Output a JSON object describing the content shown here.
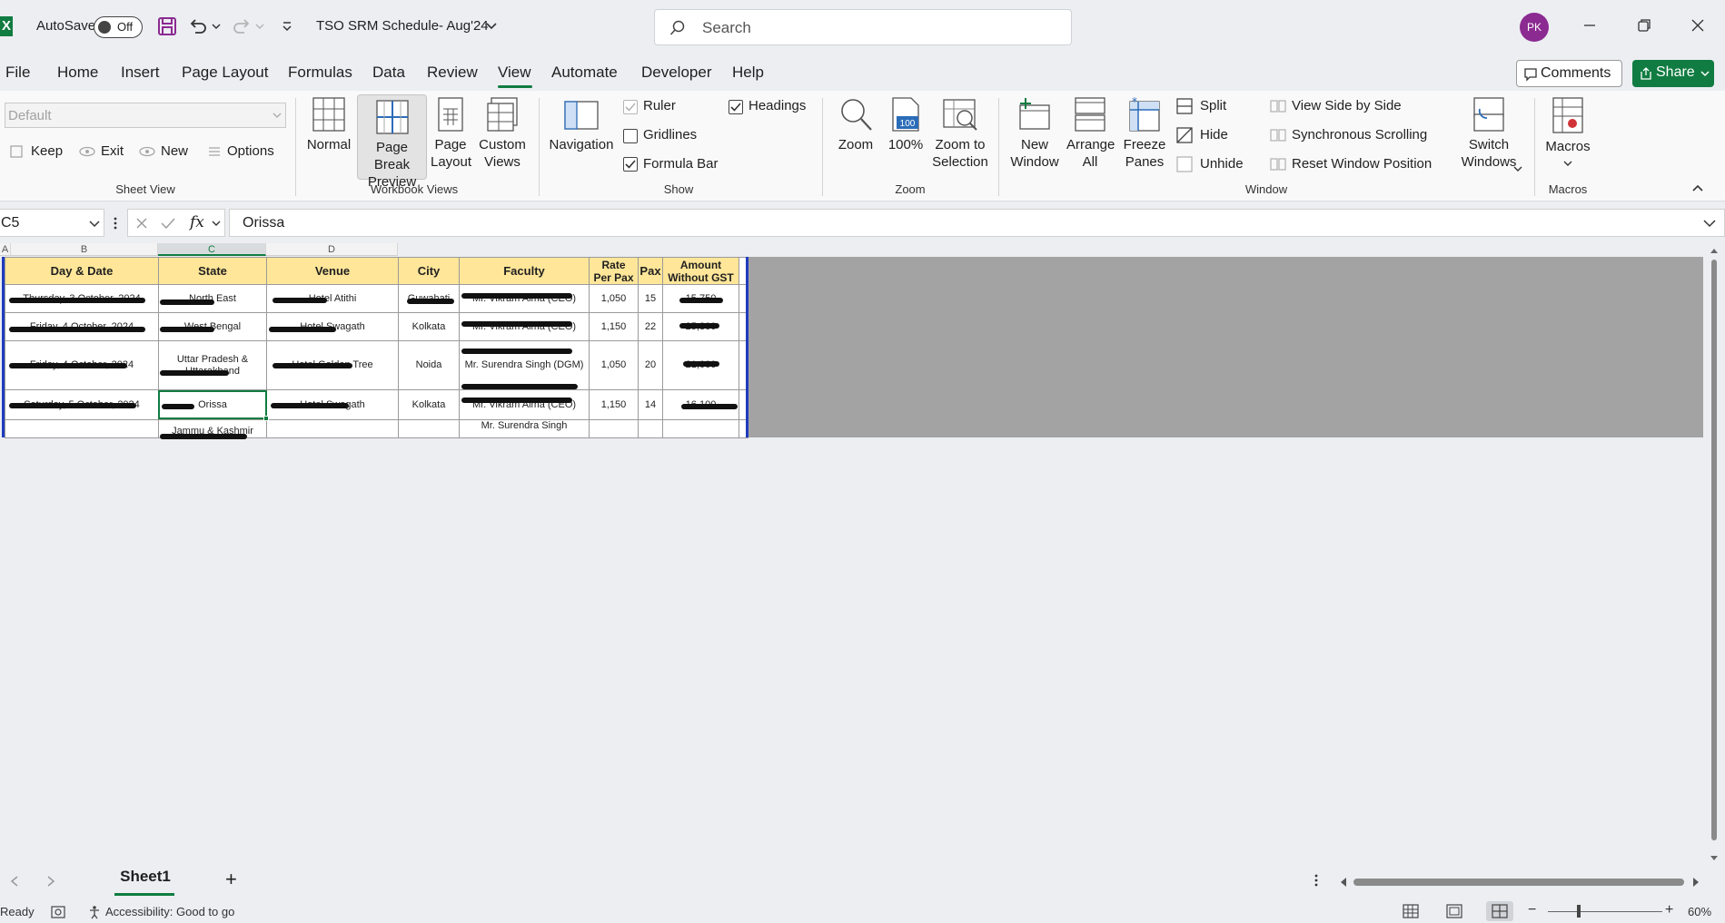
{
  "titlebar": {
    "autosave_label": "AutoSave",
    "autosave_state": "Off",
    "doc_title": "TSO SRM Schedule- Aug'24",
    "search_placeholder": "Search",
    "user_initials": "PK"
  },
  "menu": {
    "tabs": [
      "File",
      "Home",
      "Insert",
      "Page Layout",
      "Formulas",
      "Data",
      "Review",
      "View",
      "Automate",
      "Developer",
      "Help"
    ],
    "active_tab": "View",
    "comments_label": "Comments",
    "share_label": "Share"
  },
  "ribbon": {
    "sheet_view": {
      "select_value": "Default",
      "keep": "Keep",
      "exit": "Exit",
      "new": "New",
      "options": "Options",
      "group_label": "Sheet View"
    },
    "workbook_views": {
      "normal": "Normal",
      "page_break_1": "Page Break",
      "page_break_2": "Preview",
      "page_layout_1": "Page",
      "page_layout_2": "Layout",
      "custom_views_1": "Custom",
      "custom_views_2": "Views",
      "group_label": "Workbook Views"
    },
    "show": {
      "navigation": "Navigation",
      "ruler": "Ruler",
      "gridlines": "Gridlines",
      "formula_bar": "Formula Bar",
      "headings": "Headings",
      "group_label": "Show"
    },
    "zoom": {
      "zoom": "Zoom",
      "hundred": "100%",
      "hundred_icon": "100",
      "zoom_sel_1": "Zoom to",
      "zoom_sel_2": "Selection",
      "group_label": "Zoom"
    },
    "window": {
      "new_window_1": "New",
      "new_window_2": "Window",
      "arrange_1": "Arrange",
      "arrange_2": "All",
      "freeze_1": "Freeze",
      "freeze_2": "Panes",
      "split": "Split",
      "hide": "Hide",
      "unhide": "Unhide",
      "side_by_side": "View Side by Side",
      "sync_scroll": "Synchronous Scrolling",
      "reset_pos": "Reset Window Position",
      "switch_1": "Switch",
      "switch_2": "Windows",
      "group_label": "Window"
    },
    "macros": {
      "macros": "Macros",
      "group_label": "Macros"
    }
  },
  "formula_bar": {
    "name_box": "C5",
    "fx": "fx",
    "content": "Orissa"
  },
  "grid": {
    "col_headers": [
      "A",
      "B",
      "C",
      "D"
    ],
    "headers": [
      "Day & Date",
      "State",
      "Venue",
      "City",
      "Faculty",
      "Rate Per Pax",
      "Pax",
      "Amount Without GST"
    ],
    "header_rate_1": "Rate",
    "header_rate_2": "Per Pax",
    "header_amt_1": "Amount",
    "header_amt_2": "Without GST",
    "rows": [
      {
        "day": "Thursday, 3 October, 2024",
        "state": "North East",
        "venue": "Hotel Atithi",
        "city": "Guwahati",
        "faculty": "Mr. Vikram Alma (CEO)",
        "rate": "1,050",
        "pax": "15",
        "amount": "15,750"
      },
      {
        "day": "Friday, 4 October, 2024",
        "state": "West Bengal",
        "venue": "Hotel Swagath",
        "city": "Kolkata",
        "faculty": "Mr. Vikram Alma (CEO)",
        "rate": "1,150",
        "pax": "22",
        "amount": "25,300"
      },
      {
        "day": "Friday, 4 October, 2024",
        "state": "Uttar Pradesh & Uttarakhand",
        "venue": "Hotel Golden Tree",
        "city": "Noida",
        "faculty": "Mr. Surendra Singh (DGM)",
        "rate": "1,050",
        "pax": "20",
        "amount": "21,000"
      },
      {
        "day": "Saturday, 5 October, 2024",
        "state": "Orissa",
        "venue": "Hotel Swagath",
        "city": "Kolkata",
        "faculty": "Mr. Vikram Alma (CEO)",
        "rate": "1,150",
        "pax": "14",
        "amount": "16,100"
      },
      {
        "day": "",
        "state": "Jammu & Kashmir",
        "venue": "",
        "city": "",
        "faculty": "Mr. Surendra Singh",
        "rate": "",
        "pax": "",
        "amount": ""
      }
    ]
  },
  "sheet_tabs": {
    "active": "Sheet1",
    "add_label": "+"
  },
  "status": {
    "ready": "Ready",
    "accessibility": "Accessibility: Good to go",
    "zoom_level": "60%"
  }
}
